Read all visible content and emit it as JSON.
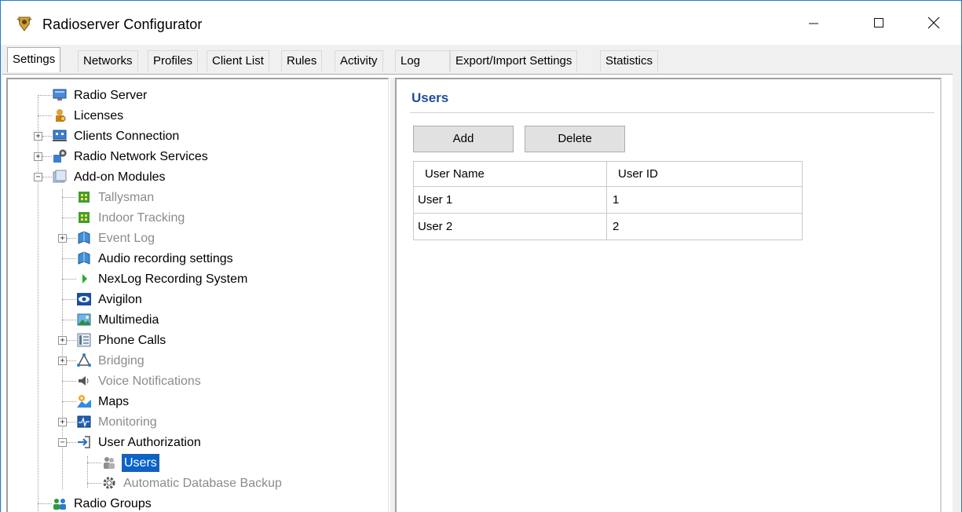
{
  "window": {
    "title": "Radioserver Configurator",
    "controls": {
      "minimize": "—",
      "maximize": "☐",
      "close": "✕"
    }
  },
  "tabs": [
    {
      "label": "Settings",
      "active": true
    },
    {
      "label": "Networks"
    },
    {
      "label": "Profiles"
    },
    {
      "label": "Client List"
    },
    {
      "label": "Rules"
    },
    {
      "label": "Activity"
    },
    {
      "label": "Log"
    },
    {
      "label": "Export/Import Settings"
    },
    {
      "label": "Statistics"
    }
  ],
  "tree": {
    "items": [
      {
        "label": "Radio Server",
        "icon": "monitor-icon"
      },
      {
        "label": "Licenses",
        "icon": "key-person-icon"
      },
      {
        "label": "Clients Connection",
        "icon": "network-icon"
      },
      {
        "label": "Radio Network Services",
        "icon": "radio-services-icon"
      },
      {
        "label": "Add-on Modules",
        "icon": "modules-icon"
      },
      {
        "label": "Tallysman",
        "icon": "chip-icon",
        "dim": true
      },
      {
        "label": "Indoor Tracking",
        "icon": "chip-icon",
        "dim": true
      },
      {
        "label": "Event Log",
        "icon": "book-icon",
        "dim": true
      },
      {
        "label": "Audio recording settings",
        "icon": "book-icon"
      },
      {
        "label": "NexLog Recording System",
        "icon": "play-icon"
      },
      {
        "label": "Avigilon",
        "icon": "eye-icon"
      },
      {
        "label": "Multimedia",
        "icon": "image-icon"
      },
      {
        "label": "Phone Calls",
        "icon": "phone-icon"
      },
      {
        "label": "Bridging",
        "icon": "bridge-icon",
        "dim": true
      },
      {
        "label": "Voice Notifications",
        "icon": "speaker-icon",
        "dim": true
      },
      {
        "label": "Maps",
        "icon": "map-icon"
      },
      {
        "label": "Monitoring",
        "icon": "monitor-wave-icon",
        "dim": true
      },
      {
        "label": "User Authorization",
        "icon": "login-arrow-icon"
      },
      {
        "label": "Users",
        "icon": "users-icon",
        "selected": true
      },
      {
        "label": "Automatic Database Backup",
        "icon": "gear-icon",
        "dim": true
      },
      {
        "label": "Radio Groups",
        "icon": "group-icon"
      }
    ]
  },
  "users_panel": {
    "title": "Users",
    "add_label": "Add",
    "delete_label": "Delete",
    "columns": [
      "User Name",
      "User ID"
    ],
    "rows": [
      [
        "User 1",
        "1"
      ],
      [
        "User 2",
        "2"
      ]
    ]
  },
  "colors": {
    "accent": "#1f4e96",
    "selection": "#0a63cb",
    "window_border": "#1f7bd6"
  }
}
